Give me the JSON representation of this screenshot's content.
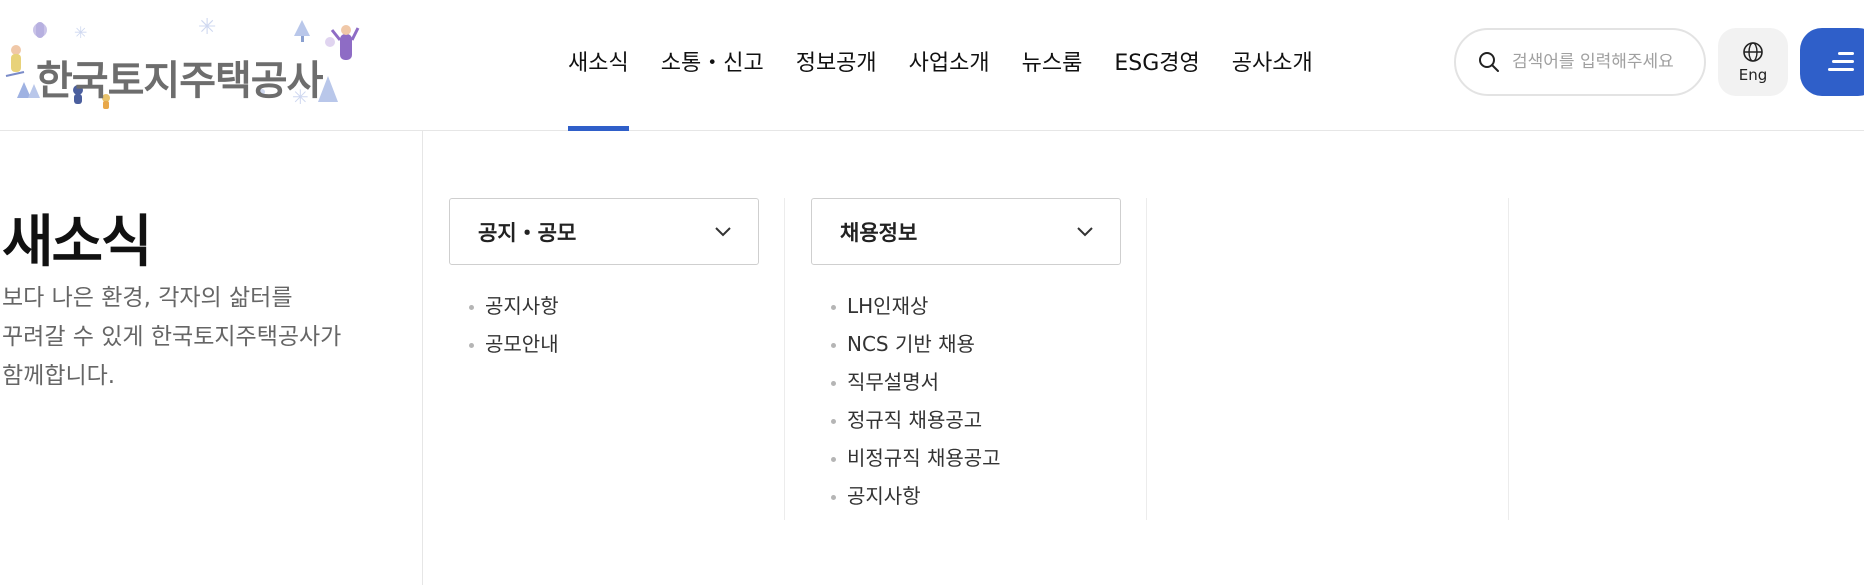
{
  "header": {
    "logo_text": "한국토지주택공사",
    "nav": [
      {
        "label": "새소식",
        "active": true
      },
      {
        "label": "소통・신고",
        "active": false
      },
      {
        "label": "정보공개",
        "active": false
      },
      {
        "label": "사업소개",
        "active": false
      },
      {
        "label": "뉴스룸",
        "active": false
      },
      {
        "label": "ESG경영",
        "active": false
      },
      {
        "label": "공사소개",
        "active": false
      }
    ],
    "search": {
      "placeholder": "검색어를 입력해주세요",
      "value": ""
    },
    "lang_label": "Eng"
  },
  "panel": {
    "title": "새소식",
    "desc_lines": [
      "보다 나은 환경, 각자의 삶터를",
      "꾸려갈 수 있게 한국토지주택공사가",
      "함께합니다."
    ]
  },
  "columns": [
    {
      "title": "공지・공모",
      "items": [
        "공지사항",
        "공모안내"
      ]
    },
    {
      "title": "채용정보",
      "items": [
        "LH인재상",
        "NCS 기반 채용",
        "직무설명서",
        "정규직 채용공고",
        "비정규직 채용공고",
        "공지사항"
      ]
    }
  ],
  "colors": {
    "accent": "#2f5fc9",
    "logo_text": "#6d6d6d",
    "divider": "#e6e6e6"
  }
}
